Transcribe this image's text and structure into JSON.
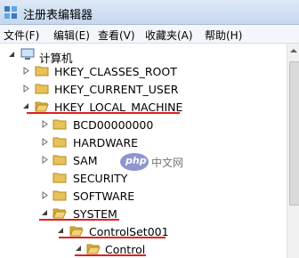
{
  "window": {
    "title": "注册表编辑器",
    "app_icon": "registry-editor-icon"
  },
  "menu": [
    "文件(F)",
    "编辑(E)",
    "查看(V)",
    "收藏夹(A)",
    "帮助(H)"
  ],
  "tree": {
    "root": "计算机",
    "hkcr": "HKEY_CLASSES_ROOT",
    "hkcu": "HKEY_CURRENT_USER",
    "hklm": "HKEY_LOCAL_MACHINE",
    "bcd": "BCD00000000",
    "hardware": "HARDWARE",
    "sam": "SAM",
    "security": "SECURITY",
    "software": "SOFTWARE",
    "system": "SYSTEM",
    "controlset": "ControlSet001",
    "control": "Control"
  },
  "watermark": {
    "logo_text": "php",
    "site_text": "中文网"
  },
  "colors": {
    "highlight_underline": "#e02020",
    "folder": "#e8c15a"
  }
}
